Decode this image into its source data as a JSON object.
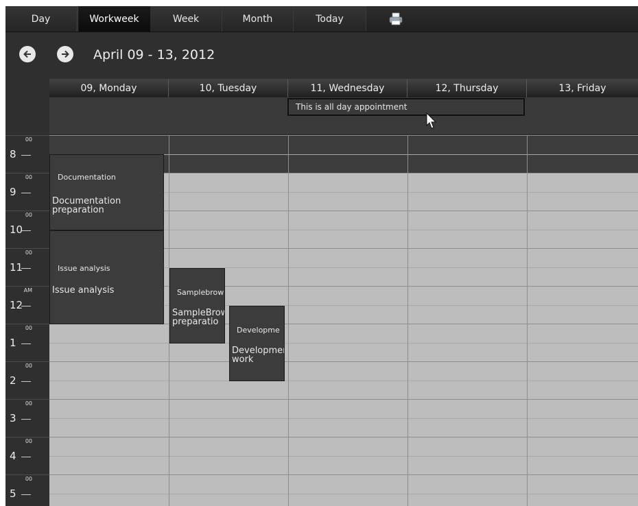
{
  "toolbar": {
    "buttons": [
      "Day",
      "Workweek",
      "Week",
      "Month",
      "Today"
    ],
    "active": "Workweek",
    "print_icon": "printer-icon"
  },
  "nav": {
    "prev_icon": "arrow-left-icon",
    "next_icon": "arrow-right-icon",
    "range": "April 09 - 13, 2012"
  },
  "days": [
    "09, Monday",
    "10, Tuesday",
    "11, Wednesday",
    "12, Thursday",
    "13, Friday"
  ],
  "all_day": {
    "text": "This is all day appointment",
    "day": "11, Wednesday"
  },
  "hours": [
    {
      "num": "8",
      "min": "00"
    },
    {
      "num": "9",
      "min": "00"
    },
    {
      "num": "10",
      "min": "00"
    },
    {
      "num": "11",
      "min": "00"
    },
    {
      "num": "12",
      "min": "AM"
    },
    {
      "num": "1",
      "min": "00"
    },
    {
      "num": "2",
      "min": "00"
    },
    {
      "num": "3",
      "min": "00"
    },
    {
      "num": "4",
      "min": "00"
    },
    {
      "num": "5",
      "min": "00"
    }
  ],
  "appointments": [
    {
      "subject": "Documentation",
      "body": "Documentation preparation",
      "day": "09, Monday",
      "start": "8:30",
      "end": "10:30"
    },
    {
      "subject": "Issue analysis",
      "body": "Issue analysis",
      "day": "09, Monday",
      "start": "10:30",
      "end": "1:00"
    },
    {
      "subject": "Samplebrow",
      "body": "SampleBrow preparatio",
      "day": "10, Tuesday",
      "start": "11:30",
      "end": "1:30"
    },
    {
      "subject": "Developme",
      "body": "Developmer work",
      "day": "10, Tuesday",
      "start": "12:30",
      "end": "2:30"
    }
  ],
  "colors": {
    "chrome": "#2f2f2f",
    "grid": "#bdbdbd",
    "appointment": "#3c3c3c",
    "text": "#e8e8e8"
  }
}
